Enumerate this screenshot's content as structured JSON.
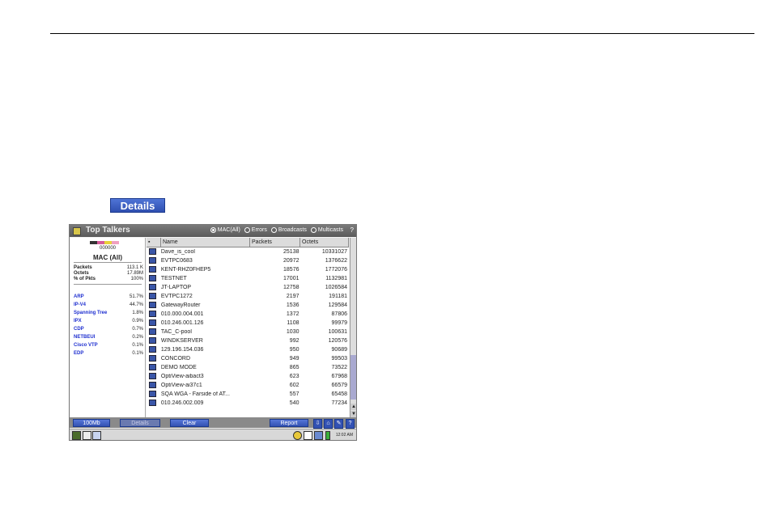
{
  "details_button": {
    "label": "Details"
  },
  "window": {
    "title": "Top Talkers",
    "filters": [
      {
        "label": "MAC(All)",
        "selected": true
      },
      {
        "label": "Errors",
        "selected": false
      },
      {
        "label": "Broadcasts",
        "selected": false
      },
      {
        "label": "Multicasts",
        "selected": false
      }
    ]
  },
  "left_panel": {
    "counter": "000000",
    "selection_label": "MAC (All)",
    "stats": [
      {
        "key": "Packets",
        "value": "113.1 K"
      },
      {
        "key": "Octets",
        "value": "17.89M"
      },
      {
        "key": "% of Pkts",
        "value": "100%"
      }
    ],
    "protocols": [
      {
        "key": "ARP",
        "value": "51.7%"
      },
      {
        "key": "IP-V4",
        "value": "44.7%"
      },
      {
        "key": "Spanning Tree",
        "value": "1.8%"
      },
      {
        "key": "IPX",
        "value": "0.9%"
      },
      {
        "key": "CDP",
        "value": "0.7%"
      },
      {
        "key": "NETBEUI",
        "value": "0.2%"
      },
      {
        "key": "Cisco VTP",
        "value": "0.1%"
      },
      {
        "key": "EDP",
        "value": "0.1%"
      }
    ]
  },
  "table": {
    "columns": [
      "Name",
      "Packets",
      "Octets"
    ],
    "rows": [
      [
        "Dave_is_cool",
        "25138",
        "10331027"
      ],
      [
        "EVTPC0683",
        "20972",
        "1376622"
      ],
      [
        "KENT-RHZ0FHEP5",
        "18576",
        "1772076"
      ],
      [
        "TESTNET",
        "17001",
        "1132981"
      ],
      [
        "JT-LAPTOP",
        "12758",
        "1026584"
      ],
      [
        "EVTPC1272",
        "2197",
        "191181"
      ],
      [
        "GatewayRouter",
        "1536",
        "129584"
      ],
      [
        "010.000.004.001",
        "1372",
        "87806"
      ],
      [
        "010.246.001.126",
        "1108",
        "99979"
      ],
      [
        "TAC_C-pool",
        "1030",
        "100631"
      ],
      [
        "WINDKSERVER",
        "992",
        "120576"
      ],
      [
        "129.196.154.036",
        "950",
        "90689"
      ],
      [
        "CONCORD",
        "949",
        "99503"
      ],
      [
        "DEMO MODE",
        "865",
        "73522"
      ],
      [
        "OptiView-aibact3",
        "623",
        "67968"
      ],
      [
        "OptiView-ai37c1",
        "602",
        "66579"
      ],
      [
        "SQA WGA - Farside of AT...",
        "557",
        "65458"
      ],
      [
        "010.246.002.009",
        "540",
        "77234"
      ]
    ]
  },
  "toolbar": {
    "speed_label": "100Mb",
    "details_label": "Details",
    "clear_label": "Clear",
    "report_label": "Report"
  },
  "statusbar": {
    "clock": "12:02 AM"
  }
}
